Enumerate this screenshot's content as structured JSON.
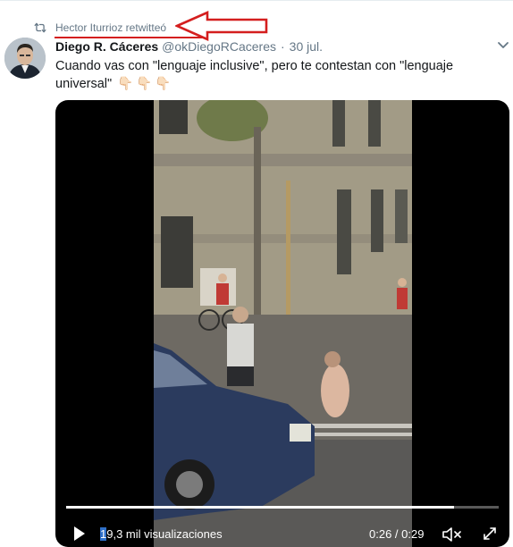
{
  "retweet": {
    "icon": "retweet-icon",
    "text": "Hector Iturrioz retwitteó",
    "annotation_color": "#d41e1e"
  },
  "tweet": {
    "author_name": "Diego R. Cáceres",
    "author_handle": "@okDiegoRCaceres",
    "separator": "·",
    "date": "30 jul.",
    "text": "Cuando vas con \"lenguaje inclusive\", pero te contestan con \"lenguaje universal\"",
    "emojis": "👇🏻👇🏻👇🏻"
  },
  "video": {
    "views_label": "19,3 mil visualizaciones",
    "views_first_char": "1",
    "views_rest": "9,3 mil visualizaciones",
    "time_elapsed": "0:26",
    "time_separator": " / ",
    "time_total": "0:29",
    "progress_fraction": 0.897
  },
  "colors": {
    "text_primary": "#14171a",
    "text_secondary": "#657786",
    "video_bg": "#000000"
  }
}
